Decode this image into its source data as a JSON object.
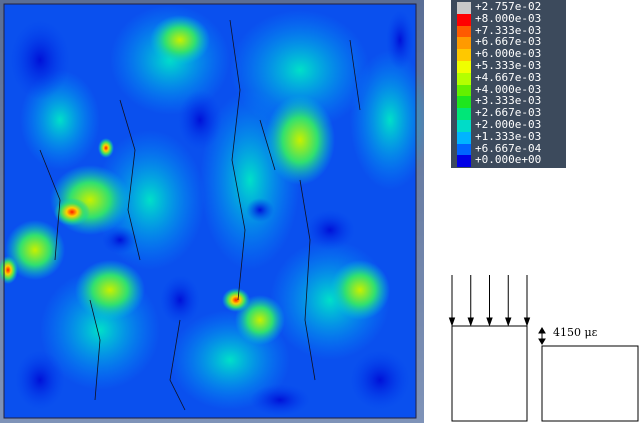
{
  "legend": {
    "items": [
      {
        "label": "+2.757e-02",
        "color": "#c8c8c8"
      },
      {
        "label": "+8.000e-03",
        "color": "#ff0000"
      },
      {
        "label": "+7.333e-03",
        "color": "#ff5a00"
      },
      {
        "label": "+6.667e-03",
        "color": "#ff9a00"
      },
      {
        "label": "+6.000e-03",
        "color": "#ffc800"
      },
      {
        "label": "+5.333e-03",
        "color": "#f0ff00"
      },
      {
        "label": "+4.667e-03",
        "color": "#b4ff00"
      },
      {
        "label": "+4.000e-03",
        "color": "#64f000"
      },
      {
        "label": "+3.333e-03",
        "color": "#1ee61e"
      },
      {
        "label": "+2.667e-03",
        "color": "#00e678"
      },
      {
        "label": "+2.000e-03",
        "color": "#00dcc8"
      },
      {
        "label": "+1.333e-03",
        "color": "#00b4ff"
      },
      {
        "label": "+6.667e-04",
        "color": "#0064ff"
      },
      {
        "label": "+0.000e+00",
        "color": "#0000e6"
      }
    ]
  },
  "schematic": {
    "strain_label": "4150 με",
    "arrow_count": 5
  }
}
